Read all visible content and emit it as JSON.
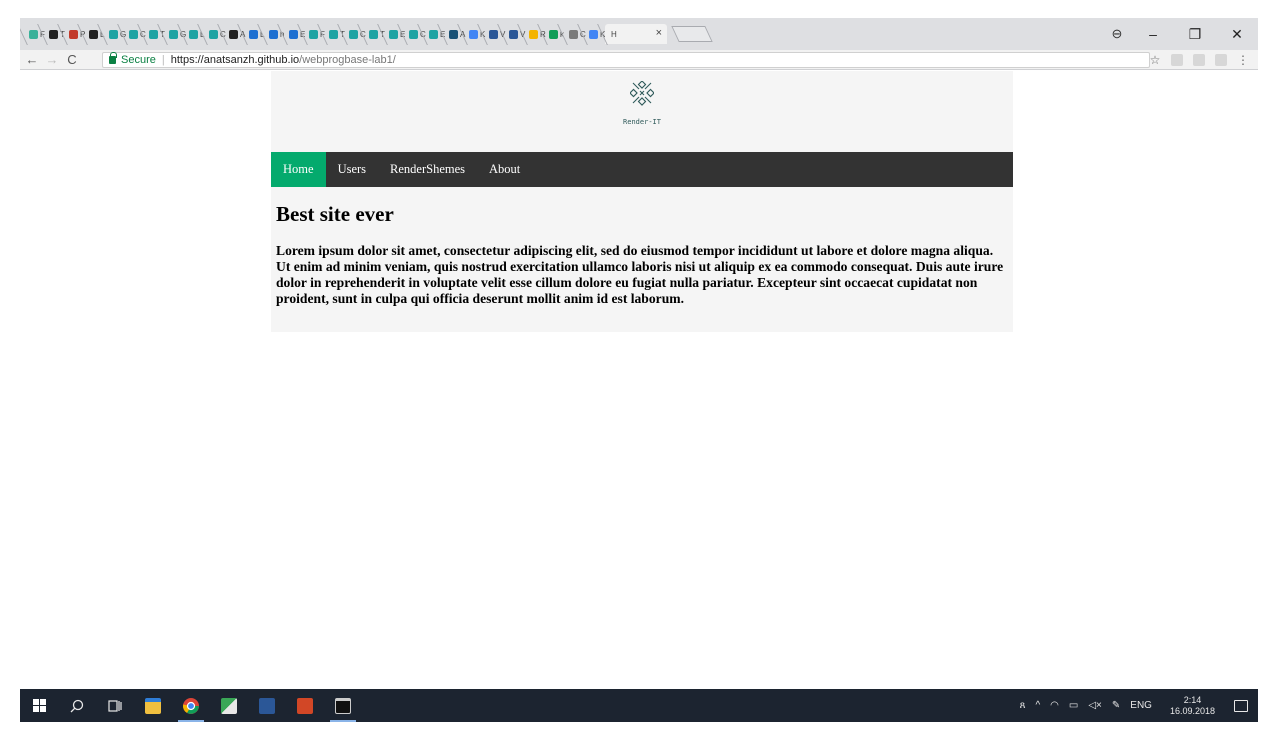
{
  "browser": {
    "tabs": [
      {
        "label": "F",
        "color": "#3bb19a"
      },
      {
        "label": "T",
        "color": "#222222"
      },
      {
        "label": "P",
        "color": "#c23a2b"
      },
      {
        "label": "L",
        "color": "#222222"
      },
      {
        "label": "G",
        "color": "#1fa3a3"
      },
      {
        "label": "C",
        "color": "#1fa3a3"
      },
      {
        "label": "T",
        "color": "#1fa3a3"
      },
      {
        "label": "G",
        "color": "#1fa3a3"
      },
      {
        "label": "L",
        "color": "#1fa3a3"
      },
      {
        "label": "C",
        "color": "#1fa3a3"
      },
      {
        "label": "A",
        "color": "#222222"
      },
      {
        "label": "L",
        "color": "#1d6fd1"
      },
      {
        "label": "h",
        "color": "#1d6fd1"
      },
      {
        "label": "E",
        "color": "#1d6fd1"
      },
      {
        "label": "F",
        "color": "#1fa3a3"
      },
      {
        "label": "T",
        "color": "#1fa3a3"
      },
      {
        "label": "C",
        "color": "#1fa3a3"
      },
      {
        "label": "T",
        "color": "#1fa3a3"
      },
      {
        "label": "E",
        "color": "#1fa3a3"
      },
      {
        "label": "C",
        "color": "#1fa3a3"
      },
      {
        "label": "E",
        "color": "#1fa3a3"
      },
      {
        "label": "A",
        "color": "#1a5276"
      },
      {
        "label": "K",
        "color": "#4285f4"
      },
      {
        "label": "V",
        "color": "#2b5797"
      },
      {
        "label": "V",
        "color": "#2b5797"
      },
      {
        "label": "R",
        "color": "#f4b400"
      },
      {
        "label": "k",
        "color": "#0f9d58"
      },
      {
        "label": "C",
        "color": "#7a7a7a"
      },
      {
        "label": "K",
        "color": "#4285f4"
      }
    ],
    "active_tab": {
      "label": "H",
      "close": "×"
    },
    "window_controls": {
      "profile": "⊖",
      "minimize": "–",
      "restore": "❐",
      "close": "✕"
    },
    "nav": {
      "back": "←",
      "forward": "→",
      "reload": "C"
    },
    "address": {
      "secure_label": "Secure",
      "url_host": "https://anatsanzh.github.io",
      "url_path": "/webprogbase-lab1/"
    },
    "toolbar_icons": {
      "star": "☆",
      "menu": "⋮"
    }
  },
  "site": {
    "logo_text": "Render-IT",
    "nav": [
      "Home",
      "Users",
      "RenderShemes",
      "About"
    ],
    "heading": "Best site ever",
    "paragraph": "Lorem ipsum dolor sit amet, consectetur adipiscing elit, sed do eiusmod tempor incididunt ut labore et dolore magna aliqua. Ut enim ad minim veniam, quis nostrud exercitation ullamco laboris nisi ut aliquip ex ea commodo consequat. Duis aute irure dolor in reprehenderit in voluptate velit esse cillum dolore eu fugiat nulla pariatur. Excepteur sint occaecat cupidatat non proident, sunt in culpa qui officia deserunt mollit anim id est laborum."
  },
  "taskbar": {
    "tray": {
      "language": "ENG",
      "time": "2:14",
      "date": "16.09.2018"
    }
  },
  "colors": {
    "nav_bg": "#333333",
    "nav_active": "#04aa6d",
    "page_bg": "#f5f5f5",
    "secure_green": "#0b8043"
  }
}
